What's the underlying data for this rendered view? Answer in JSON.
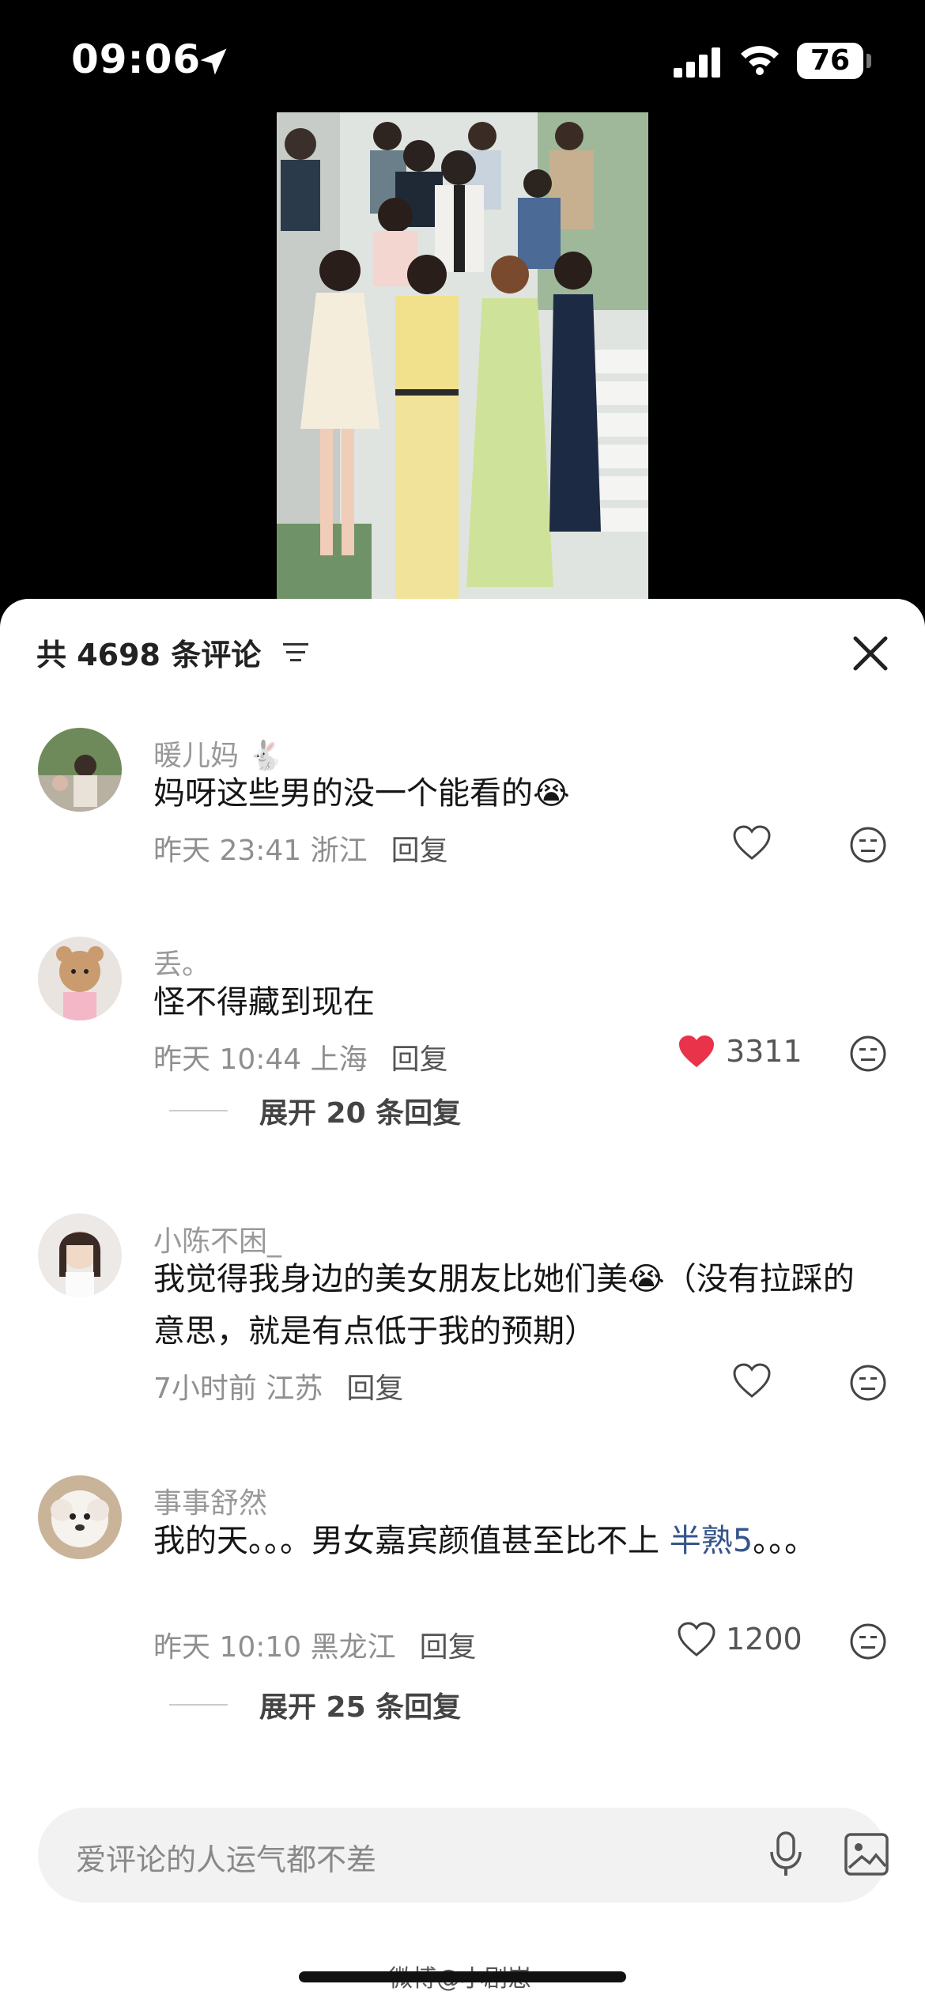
{
  "status_bar": {
    "time": "09:06",
    "battery": "76"
  },
  "sheet": {
    "count_label": "共 4698 条评论"
  },
  "comments": [
    {
      "username": "暖儿妈",
      "name_emoji": "🐇",
      "text": "妈呀这些男的没一个能看的",
      "text_emoji": "😭",
      "time": "昨天 23:41",
      "location": "浙江",
      "reply": "回复",
      "likes": "",
      "liked": false
    },
    {
      "username": "丢。",
      "text": "怪不得藏到现在",
      "time": "昨天 10:44",
      "location": "上海",
      "reply": "回复",
      "likes": "3311",
      "liked": true,
      "expand": "展开 20 条回复"
    },
    {
      "username": "小陈不困_",
      "text": "我觉得我身边的美女朋友比她们美",
      "text_emoji": "😭",
      "text_tail": "（没有拉踩的意思，就是有点低于我的预期）",
      "time": "7小时前",
      "location": "江苏",
      "reply": "回复",
      "likes": "",
      "liked": false
    },
    {
      "username": "事事舒然",
      "text": "我的天。。。男女嘉宾颜值甚至比不上 ",
      "link": "半熟5",
      "text_tail": "。。。",
      "time": "昨天 10:10",
      "location": "黑龙江",
      "reply": "回复",
      "likes": "1200",
      "liked": false,
      "expand": "展开 25 条回复"
    }
  ],
  "input": {
    "placeholder": "爱评论的人运气都不差"
  },
  "watermark": "微博@小剧崽",
  "colors": {
    "like_red": "#e8334a",
    "link_blue": "#34558b",
    "sheet_bg": "#ffffff"
  }
}
